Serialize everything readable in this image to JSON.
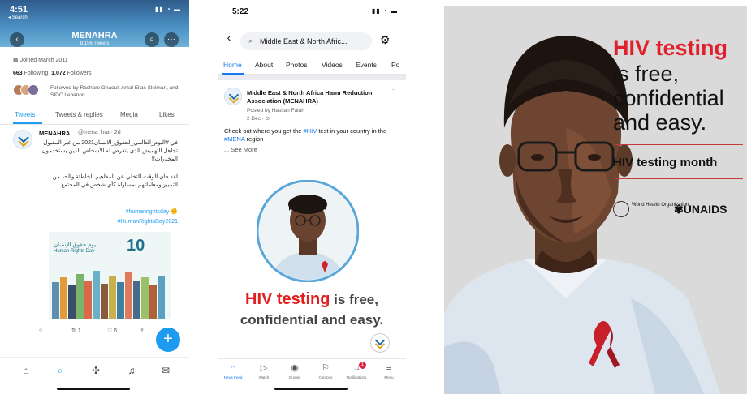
{
  "twitter": {
    "time": "4:51",
    "back_app": "◂ Search",
    "profile_name": "MENAHRA",
    "tweet_count": "8,156 Tweets",
    "joined": "Joined March 2011",
    "following_count": "663",
    "following_label": "Following",
    "followers_count": "1,072",
    "followers_label": "Followers",
    "followed_by": "Followed by Rachare Ghaoul, Amal Elias Sleiman, and SIDC Lebanon",
    "tabs": [
      "Tweets",
      "Tweets & replies",
      "Media",
      "Likes"
    ],
    "tweet": {
      "name": "MENAHRA",
      "handle": "@mena_hra · 2d",
      "ar_line1": "في #اليوم_العالمي_لحقوق_الانسان2021 من غير المقبول تجاهل التهميش الذي يتعرض له الأشخاص الذين يستخدمون المخدرات!!",
      "ar_line2": "لقد حان الوقت للتخلي عن المفاهيم الخاطئة والحد من التمييز ومعاملتهم بمساواة كأي شخص في المجتمع",
      "hashtag1": "#humanrightsday ✊",
      "hashtag2": "#HumanRightsDay2021",
      "image_title_ar": "يوم حقوق الإنسان",
      "image_title_en": "Human Rights Day",
      "image_number": "10",
      "replies": "",
      "retweets": "1",
      "likes": "6"
    },
    "fab": "+"
  },
  "facebook": {
    "time": "5:22",
    "search_text": "Middle East & North Afric...",
    "tabs": [
      "Home",
      "About",
      "Photos",
      "Videos",
      "Events",
      "Po"
    ],
    "page_name": "Middle East & North Africa Harm Reduction Association (MENAHRA)",
    "posted_by": "Posted by Hassan Falah",
    "date": "2 Dec · ⊙",
    "post_text_1": "Check out where you get the ",
    "post_tag_hiv": "#HIV",
    "post_text_2": " test in your country in the ",
    "post_tag_mena": "#MENA",
    "post_text_3": " region",
    "see_more": "... See More",
    "headline_red": "HIV testing",
    "headline_rest": " is free,",
    "headline_line2": "confidential and easy.",
    "nav": [
      {
        "label": "News Feed"
      },
      {
        "label": "Watch"
      },
      {
        "label": "Groups"
      },
      {
        "label": "Campus"
      },
      {
        "label": "Notifications",
        "badge": "1"
      },
      {
        "label": "Menu"
      }
    ]
  },
  "poster": {
    "title_red": "HIV testing",
    "line1": "is free,",
    "line2": "confidential",
    "line3": "and easy.",
    "month": "HIV testing month",
    "who_text": "World Health Organization",
    "unaids": "UNAIDS",
    "colors": {
      "accent": "#e0202c",
      "background": "#d9dad9"
    }
  }
}
